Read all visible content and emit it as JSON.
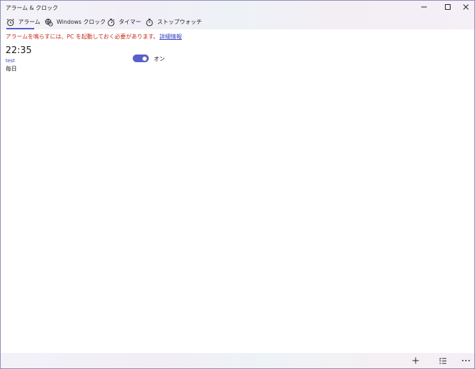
{
  "window": {
    "title": "アラーム & クロック",
    "minimize_glyph": "—",
    "maximize_glyph": "☐",
    "close_glyph": "✕"
  },
  "tabs": [
    {
      "label": "アラーム",
      "icon": "alarm-clock-icon",
      "selected": true
    },
    {
      "label": "Windows クロック",
      "icon": "world-clock-icon",
      "selected": false
    },
    {
      "label": "タイマー",
      "icon": "timer-icon",
      "selected": false
    },
    {
      "label": "ストップウォッチ",
      "icon": "stopwatch-icon",
      "selected": false
    }
  ],
  "warning": {
    "text": "アラームを鳴らすには、PC を起動しておく必要があります。",
    "link": "詳細情報"
  },
  "alarm": {
    "time": "22:35",
    "name": "test",
    "repeat": "毎日",
    "enabled": true,
    "toggle_label": "オン"
  },
  "bottombar": {
    "add_icon": "plus-icon",
    "select_icon": "multi-select-icon",
    "more_icon": "more-icon"
  },
  "colors": {
    "accent": "#5b5fc7",
    "link": "#3a45c4",
    "warning": "#c42b1c"
  }
}
